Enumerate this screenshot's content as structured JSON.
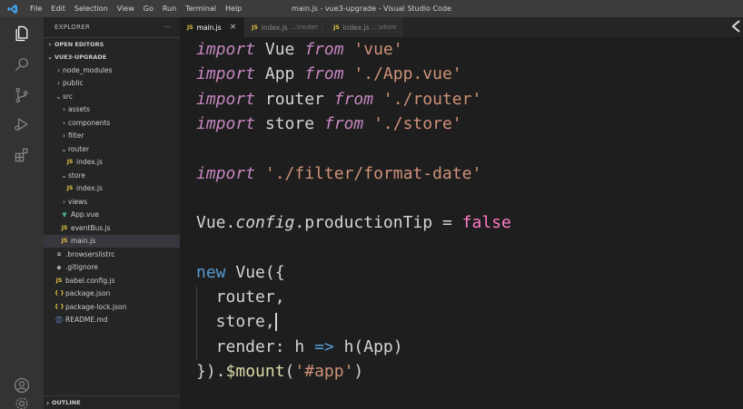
{
  "window": {
    "title": "main.js - vue3-upgrade - Visual Studio Code",
    "menu": [
      "File",
      "Edit",
      "Selection",
      "View",
      "Go",
      "Run",
      "Terminal",
      "Help"
    ]
  },
  "activity": [
    "files-icon",
    "search-icon",
    "source-control-icon",
    "run-debug-icon",
    "extensions-icon",
    "account-icon",
    "settings-icon"
  ],
  "sidebar": {
    "header": "EXPLORER",
    "more": "···",
    "sections": {
      "open_editors": "OPEN EDITORS",
      "project": "VUE3-UPGRADE",
      "outline": "OUTLINE"
    },
    "tree": [
      {
        "label": "node_modules",
        "type": "folder",
        "open": false,
        "depth": 1
      },
      {
        "label": "public",
        "type": "folder",
        "open": false,
        "depth": 1
      },
      {
        "label": "src",
        "type": "folder",
        "open": true,
        "depth": 1
      },
      {
        "label": "assets",
        "type": "folder",
        "open": false,
        "depth": 2
      },
      {
        "label": "components",
        "type": "folder",
        "open": false,
        "depth": 2
      },
      {
        "label": "filter",
        "type": "folder",
        "open": false,
        "depth": 2
      },
      {
        "label": "router",
        "type": "folder",
        "open": true,
        "depth": 2
      },
      {
        "label": "index.js",
        "type": "js",
        "depth": 3
      },
      {
        "label": "store",
        "type": "folder",
        "open": true,
        "depth": 2
      },
      {
        "label": "index.js",
        "type": "js",
        "depth": 3
      },
      {
        "label": "views",
        "type": "folder",
        "open": false,
        "depth": 2
      },
      {
        "label": "App.vue",
        "type": "vue",
        "depth": 2
      },
      {
        "label": "eventBus.js",
        "type": "js",
        "depth": 2
      },
      {
        "label": "main.js",
        "type": "js",
        "depth": 2,
        "active": true
      },
      {
        "label": ".browserslistrc",
        "type": "plain",
        "depth": 1
      },
      {
        "label": ".gitignore",
        "type": "gear",
        "depth": 1
      },
      {
        "label": "babel.config.js",
        "type": "js",
        "depth": 1
      },
      {
        "label": "package.json",
        "type": "json",
        "depth": 1
      },
      {
        "label": "package-lock.json",
        "type": "json",
        "depth": 1
      },
      {
        "label": "README.md",
        "type": "info",
        "depth": 1
      }
    ]
  },
  "tabs": [
    {
      "label": "main.js",
      "desc": "",
      "active": true,
      "close": "×"
    },
    {
      "label": "index.js",
      "desc": "...\\router",
      "active": false
    },
    {
      "label": "index.js",
      "desc": "...\\store",
      "active": false
    }
  ],
  "editor": {
    "lines": [
      [
        {
          "t": "import",
          "c": "kw-i"
        },
        {
          "t": " Vue "
        },
        {
          "t": "from",
          "c": "kw-i"
        },
        {
          "t": " 'vue'",
          "c": "str"
        }
      ],
      [
        {
          "t": "import",
          "c": "kw-i"
        },
        {
          "t": " App "
        },
        {
          "t": "from",
          "c": "kw-i"
        },
        {
          "t": " './App.vue'",
          "c": "str"
        }
      ],
      [
        {
          "t": "import",
          "c": "kw-i"
        },
        {
          "t": " router "
        },
        {
          "t": "from",
          "c": "kw-i"
        },
        {
          "t": " './router'",
          "c": "str"
        }
      ],
      [
        {
          "t": "import",
          "c": "kw-i"
        },
        {
          "t": " store "
        },
        {
          "t": "from",
          "c": "kw-i"
        },
        {
          "t": " './store'",
          "c": "str"
        }
      ],
      [],
      [
        {
          "t": "import",
          "c": "kw-i"
        },
        {
          "t": " './filter/format-date'",
          "c": "str"
        }
      ],
      [],
      [
        {
          "t": "Vue."
        },
        {
          "t": "config",
          "c": "prop-i"
        },
        {
          "t": "."
        },
        {
          "t": "productionTip"
        },
        {
          "t": " = "
        },
        {
          "t": "false",
          "c": "bool"
        }
      ],
      [],
      [
        {
          "t": "new ",
          "c": "kw"
        },
        {
          "t": "Vue("
        },
        {
          "t": "{"
        }
      ],
      [
        {
          "t": "  router,"
        }
      ],
      [
        {
          "t": "  store,"
        },
        {
          "cursor": true
        }
      ],
      [
        {
          "t": "  render"
        },
        {
          "t": ": h "
        },
        {
          "t": "=>",
          "c": "kw"
        },
        {
          "t": " h(App)"
        }
      ],
      [
        {
          "t": "})."
        },
        {
          "t": "$mount",
          "c": "fn"
        },
        {
          "t": "("
        },
        {
          "t": "'#app'",
          "c": "str"
        },
        {
          "t": ")"
        }
      ]
    ]
  }
}
